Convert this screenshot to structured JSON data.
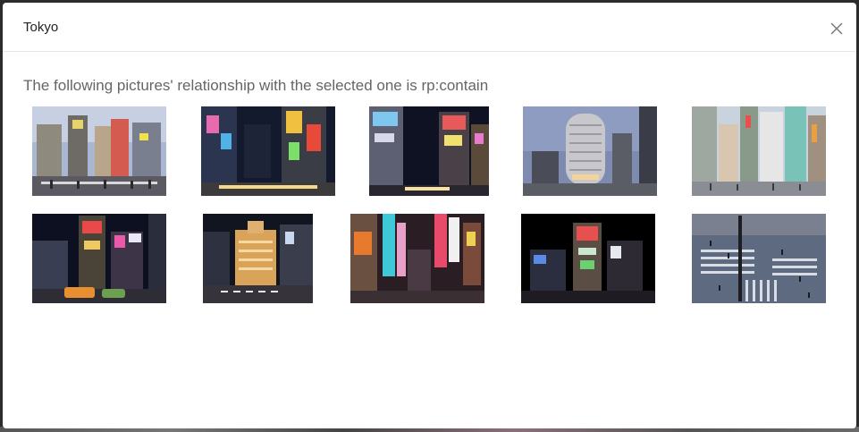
{
  "modal": {
    "title": "Tokyo",
    "description": "The following pictures' relationship with the selected one is rp:contain"
  },
  "icons": {
    "close": "close-icon"
  },
  "images": [
    {
      "name": "tokyo-photo-1",
      "scene": "shibuya-day-crossing"
    },
    {
      "name": "tokyo-photo-2",
      "scene": "ginza-night-neon"
    },
    {
      "name": "tokyo-photo-3",
      "scene": "night-street-signs"
    },
    {
      "name": "tokyo-photo-4",
      "scene": "round-building-dusk"
    },
    {
      "name": "tokyo-photo-5",
      "scene": "street-daytime"
    },
    {
      "name": "tokyo-photo-6",
      "scene": "night-intersection-taxis"
    },
    {
      "name": "tokyo-photo-7",
      "scene": "wako-clocktower-night"
    },
    {
      "name": "tokyo-photo-8",
      "scene": "alley-neon-signs"
    },
    {
      "name": "tokyo-photo-9",
      "scene": "night-corner-building"
    },
    {
      "name": "tokyo-photo-10",
      "scene": "crosswalk-aerial"
    }
  ]
}
